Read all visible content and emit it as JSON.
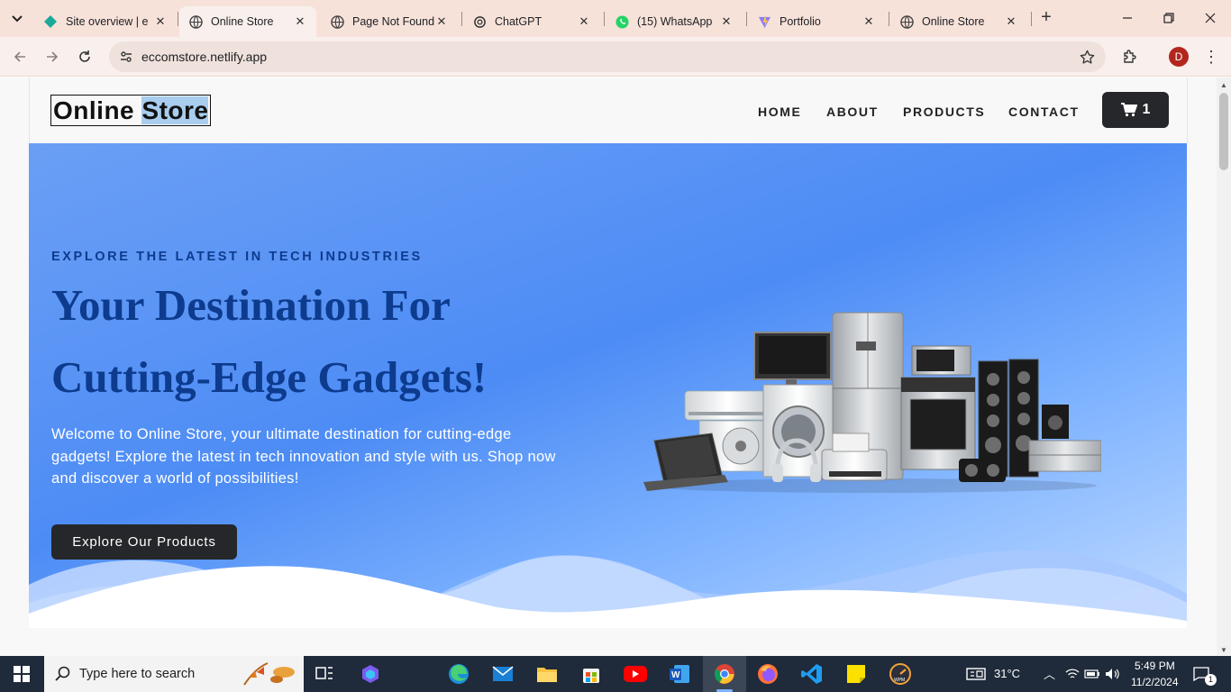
{
  "browser": {
    "tabs": [
      {
        "title": "Site overview | e",
        "icon": "netlify-icon",
        "active": false
      },
      {
        "title": "Online Store",
        "icon": "globe-icon",
        "active": true
      },
      {
        "title": "Page Not Found",
        "icon": "globe-icon",
        "active": false
      },
      {
        "title": "ChatGPT",
        "icon": "chatgpt-icon",
        "active": false
      },
      {
        "title": "(15) WhatsApp",
        "icon": "whatsapp-icon",
        "active": false
      },
      {
        "title": "Portfolio",
        "icon": "vite-icon",
        "active": false
      },
      {
        "title": "Online Store",
        "icon": "globe-icon",
        "active": false
      }
    ],
    "new_tab": "+",
    "url": "eccomstore.netlify.app",
    "profile_initial": "D",
    "colors": {
      "tabstrip": "#f7e2da",
      "toolbar": "#f9f0ed",
      "profile": "#b3261e"
    }
  },
  "site": {
    "logo": {
      "part1": "Online ",
      "part2": "Store"
    },
    "nav": [
      "HOME",
      "ABOUT",
      "PRODUCTS",
      "CONTACT"
    ],
    "cart_count": "1",
    "hero": {
      "eyebrow": "EXPLORE THE LATEST IN TECH INDUSTRIES",
      "headline_line1": "Your Destination For",
      "headline_line2": "Cutting-Edge Gadgets!",
      "lead": "Welcome to Online Store, your ultimate destination for cutting-edge gadgets! Explore the latest in tech innovation and style with us. Shop now and discover a world of possibilities!",
      "cta": "Explore Our Products"
    },
    "colors": {
      "heading": "#0d3b8e",
      "button": "#25272a",
      "hero_blue": "#4d8cf5"
    }
  },
  "taskbar": {
    "search_placeholder": "Type here to search",
    "weather": "31°C",
    "time": "5:49 PM",
    "date": "11/2/2024",
    "notifications": "1",
    "apps": [
      "task-view",
      "copilot",
      "edge",
      "mail",
      "file-explorer",
      "store",
      "youtube",
      "word",
      "chrome",
      "firefox",
      "vscode",
      "sticky-notes",
      "speedtest"
    ]
  }
}
